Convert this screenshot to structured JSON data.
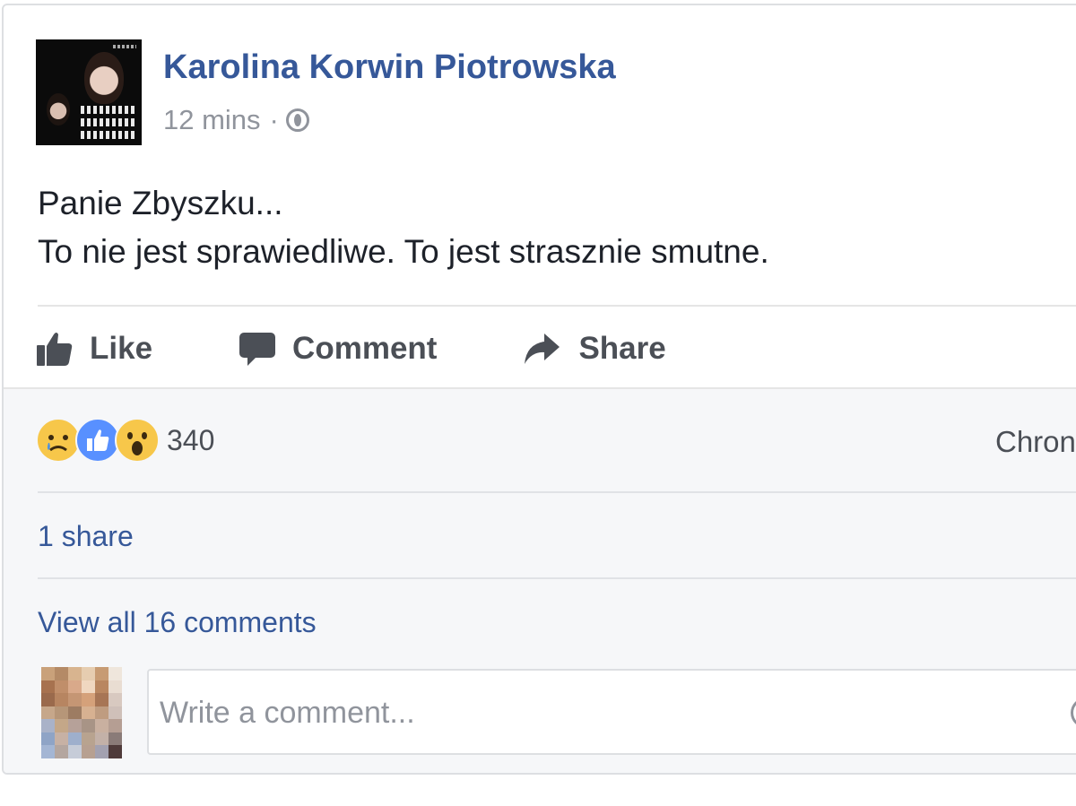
{
  "post": {
    "author": "Karolina Korwin Piotrowska",
    "time": "12 mins",
    "separator": "·",
    "privacy_icon": "globe-icon",
    "text_line1": "Panie Zbyszku...",
    "text_line2": "To nie jest sprawiedliwe. To jest strasznie smutne."
  },
  "actions": {
    "like": "Like",
    "comment": "Comment",
    "share": "Share"
  },
  "footer": {
    "reactions": [
      "sad-icon",
      "like-icon",
      "wow-icon"
    ],
    "reaction_count": "340",
    "chronology_truncated": "Chron",
    "shares": "1 share",
    "view_comments": "View all 16 comments",
    "comment_placeholder": "Write a comment..."
  },
  "colors": {
    "link": "#365899",
    "text": "#1d2129",
    "muted": "#90949c",
    "action": "#4b4f56",
    "footer_bg": "#f6f7f9",
    "like_blue": "#5890ff",
    "emoji_yellow": "#f7c74a"
  }
}
